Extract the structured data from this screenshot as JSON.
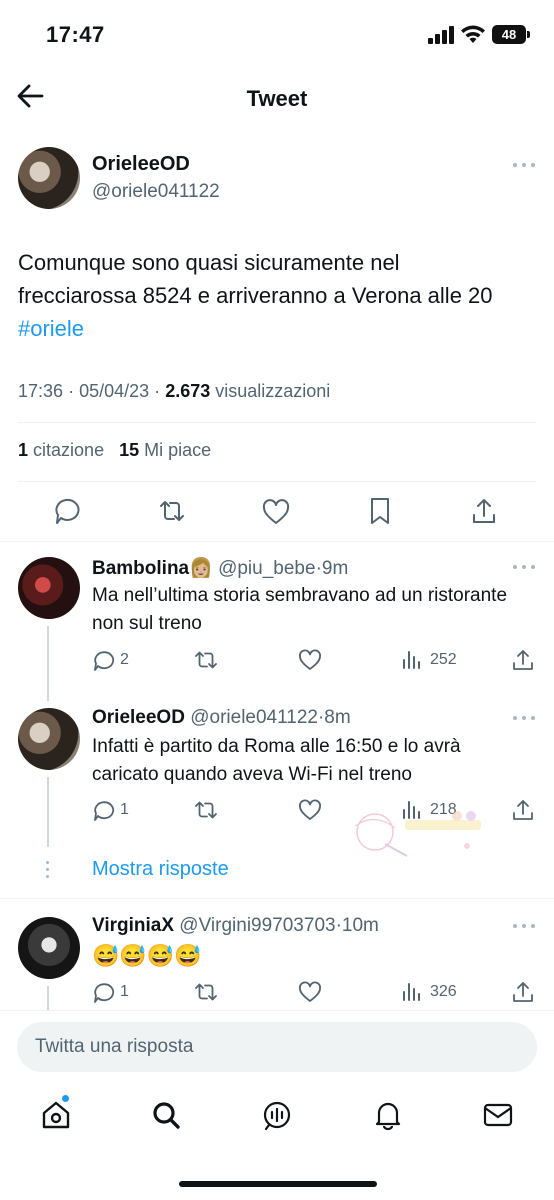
{
  "status_bar": {
    "time": "17:47",
    "battery": "48"
  },
  "header": {
    "title": "Tweet"
  },
  "tweet": {
    "author_name": "OrieleeOD",
    "author_handle": "@oriele041122",
    "text": "Comunque sono quasi sicuramente nel frecciarossa 8524 e arriveranno a Verona alle 20",
    "hashtag": "#oriele",
    "time": "17:36",
    "date": "05/04/23",
    "views": "2.673",
    "views_label": "visualizzazioni",
    "quotes_count": "1",
    "quotes_label": "citazione",
    "likes_count": "15",
    "likes_label": "Mi piace"
  },
  "replies": [
    {
      "name": "Bambolina👩🏼",
      "handle": "@piu_bebe",
      "time": "9m",
      "text": "Ma nell’ultima storia sembravano ad un ristorante non sul treno",
      "replies_count": "2",
      "views": "252"
    },
    {
      "name": "OrieleeOD",
      "handle": "@oriele041122",
      "time": "8m",
      "text": "Infatti è partito da Roma alle 16:50 e lo avrà caricato quando aveva Wi-Fi nel treno",
      "replies_count": "1",
      "views": "218"
    },
    {
      "name": "VirginiaX",
      "handle": "@Virgini99703703",
      "time": "10m",
      "text": "😅😅😅😅",
      "replies_count": "1",
      "views": "326"
    }
  ],
  "show_replies_label": "Mostra risposte",
  "separator": "·",
  "reply_box": {
    "placeholder": "Twitta una risposta"
  },
  "colors": {
    "accent": "#1d9bf0",
    "text": "#0f1419",
    "secondary": "#536471"
  },
  "nav_icons": [
    "home-icon",
    "search-icon",
    "spaces-icon",
    "notifications-icon",
    "messages-icon"
  ]
}
